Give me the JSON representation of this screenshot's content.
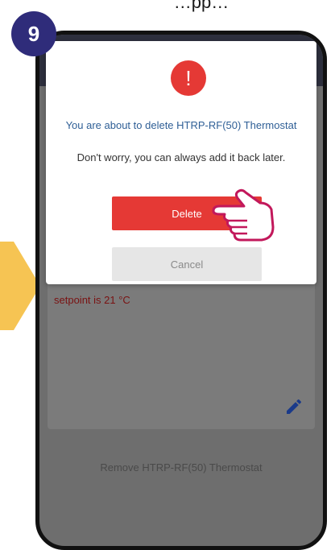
{
  "step": {
    "number": "9"
  },
  "header": {
    "text": "…pp…"
  },
  "dialog": {
    "icon": "exclamation-icon",
    "title": "You are about to delete HTRP-RF(50) Thermostat",
    "subtitle": "Don't worry, you can always add it back later.",
    "delete_label": "Delete",
    "cancel_label": "Cancel"
  },
  "background": {
    "setpoint_text": "setpoint is 21 °C",
    "remove_label": "Remove HTRP-RF(50) Thermostat",
    "edit_icon": "pencil-icon"
  },
  "colors": {
    "delete": "#e53935",
    "cancel": "#e6e6e6",
    "title_blue": "#2f5f96",
    "badge": "#2f2c7a",
    "arrow": "#f6c453"
  }
}
